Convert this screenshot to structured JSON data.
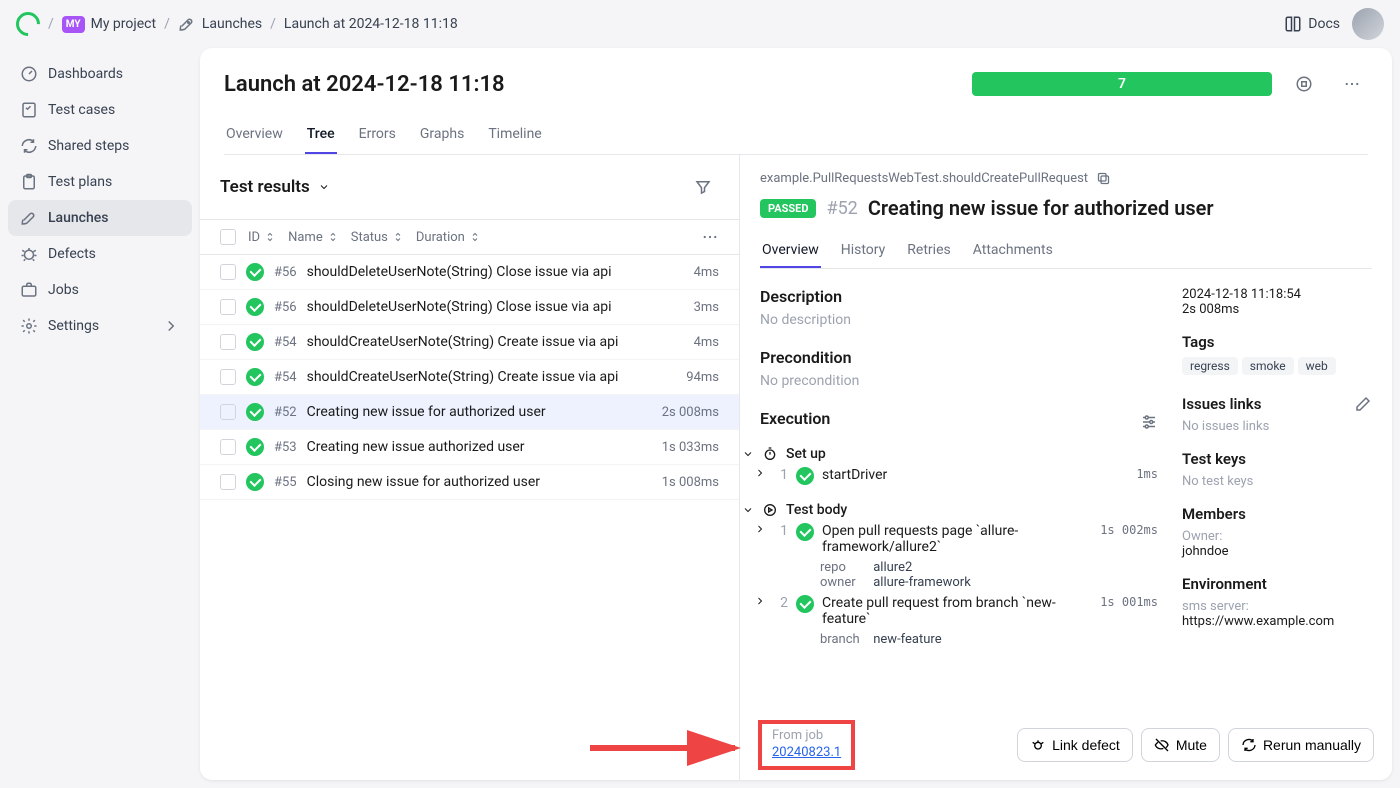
{
  "breadcrumb": {
    "project_badge": "MY",
    "project_name": "My project",
    "section": "Launches",
    "current": "Launch at 2024-12-18 11:18"
  },
  "docs_label": "Docs",
  "sidebar": {
    "items": [
      {
        "label": "Dashboards"
      },
      {
        "label": "Test cases"
      },
      {
        "label": "Shared steps"
      },
      {
        "label": "Test plans"
      },
      {
        "label": "Launches"
      },
      {
        "label": "Defects"
      },
      {
        "label": "Jobs"
      },
      {
        "label": "Settings"
      }
    ]
  },
  "header": {
    "title": "Launch at 2024-12-18 11:18",
    "progress_count": "7",
    "tabs": [
      "Overview",
      "Tree",
      "Errors",
      "Graphs",
      "Timeline"
    ],
    "active_tab": "Tree"
  },
  "results": {
    "title": "Test results",
    "columns": {
      "id": "ID",
      "name": "Name",
      "status": "Status",
      "duration": "Duration"
    },
    "rows": [
      {
        "id": "#56",
        "name": "shouldDeleteUserNote(String) Close issue via api",
        "duration": "4ms"
      },
      {
        "id": "#56",
        "name": "shouldDeleteUserNote(String) Close issue via api",
        "duration": "3ms"
      },
      {
        "id": "#54",
        "name": "shouldCreateUserNote(String) Create issue via api",
        "duration": "4ms"
      },
      {
        "id": "#54",
        "name": "shouldCreateUserNote(String) Create issue via api",
        "duration": "94ms"
      },
      {
        "id": "#52",
        "name": "Creating new issue for authorized user",
        "duration": "2s 008ms"
      },
      {
        "id": "#53",
        "name": "Creating new issue authorized user",
        "duration": "1s 033ms"
      },
      {
        "id": "#55",
        "name": "Closing new issue for authorized user",
        "duration": "1s 008ms"
      }
    ],
    "selected_index": 4
  },
  "detail": {
    "path": "example.PullRequestsWebTest.shouldCreatePullRequest",
    "status": "PASSED",
    "id": "#52",
    "name": "Creating new issue for authorized user",
    "tabs": [
      "Overview",
      "History",
      "Retries",
      "Attachments"
    ],
    "active_tab": "Overview",
    "description_title": "Description",
    "description_text": "No description",
    "precondition_title": "Precondition",
    "precondition_text": "No precondition",
    "execution_title": "Execution",
    "setup_label": "Set up",
    "setup_steps": [
      {
        "num": "1",
        "name": "startDriver",
        "duration": "1ms"
      }
    ],
    "body_label": "Test body",
    "body_steps": [
      {
        "num": "1",
        "name": "Open pull requests page `allure-framework/allure2`",
        "duration": "1s 002ms",
        "params": [
          {
            "k": "repo",
            "v": "allure2"
          },
          {
            "k": "owner",
            "v": "allure-framework"
          }
        ]
      },
      {
        "num": "2",
        "name": "Create pull request from branch `new-feature`",
        "duration": "1s 001ms",
        "params": [
          {
            "k": "branch",
            "v": "new-feature"
          }
        ]
      }
    ],
    "side": {
      "datetime": "2024-12-18 11:18:54",
      "duration": "2s 008ms",
      "tags_title": "Tags",
      "tags": [
        "regress",
        "smoke",
        "web"
      ],
      "issues_title": "Issues links",
      "issues_text": "No issues links",
      "keys_title": "Test keys",
      "keys_text": "No test keys",
      "members_title": "Members",
      "members_label": "Owner:",
      "members_value": "johndoe",
      "env_title": "Environment",
      "env_label": "sms server:",
      "env_value": "https://www.example.com"
    },
    "footer": {
      "from_job_label": "From job",
      "from_job_value": "20240823.1",
      "link_defect": "Link defect",
      "mute": "Mute",
      "rerun": "Rerun manually"
    }
  }
}
